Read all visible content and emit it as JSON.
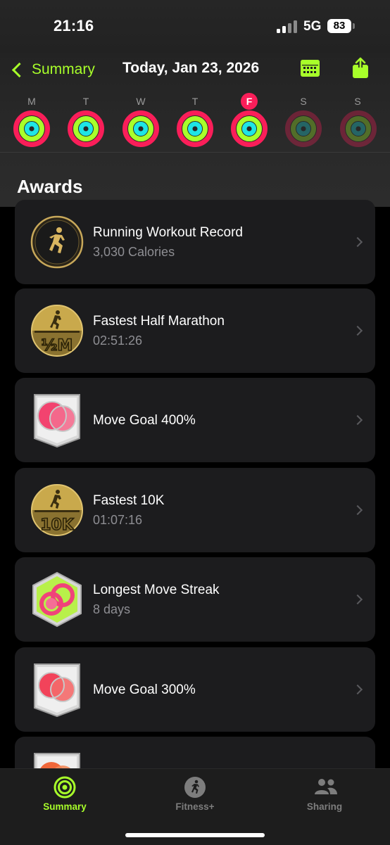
{
  "status": {
    "time": "21:16",
    "network": "5G",
    "battery": "83"
  },
  "header": {
    "back_label": "Summary",
    "date": "Today, Jan 23, 2026",
    "calendar_icon": "calendar-icon",
    "share_icon": "share-icon"
  },
  "week": {
    "days": [
      "M",
      "T",
      "W",
      "T",
      "F",
      "S",
      "S"
    ],
    "current_day_index": 4,
    "future_days": [
      5,
      6
    ]
  },
  "section_title": "Awards",
  "awards": [
    {
      "title": "Running Workout Record",
      "subtitle": "3,030 Calories",
      "badge": "running-record-badge"
    },
    {
      "title": "Fastest Half Marathon",
      "subtitle": "02:51:26",
      "badge": "half-marathon-badge"
    },
    {
      "title": "Move Goal 400%",
      "subtitle": "",
      "badge": "move-goal-400-badge"
    },
    {
      "title": "Fastest 10K",
      "subtitle": "01:07:16",
      "badge": "fastest-10k-badge"
    },
    {
      "title": "Longest Move Streak",
      "subtitle": "8 days",
      "badge": "move-streak-badge"
    },
    {
      "title": "Move Goal 300%",
      "subtitle": "",
      "badge": "move-goal-300-badge"
    },
    {
      "title": "",
      "subtitle": "",
      "badge": "move-goal-partial-badge"
    }
  ],
  "tabs": [
    {
      "label": "Summary",
      "icon": "activity-rings-icon",
      "active": true
    },
    {
      "label": "Fitness+",
      "icon": "running-figure-icon",
      "active": false
    },
    {
      "label": "Sharing",
      "icon": "people-icon",
      "active": false
    }
  ],
  "colors": {
    "accent": "#a8ff2a",
    "move": "#fa1e59",
    "exercise": "#a8ff2a",
    "stand": "#1ee5e5",
    "card": "#1c1c1e"
  }
}
